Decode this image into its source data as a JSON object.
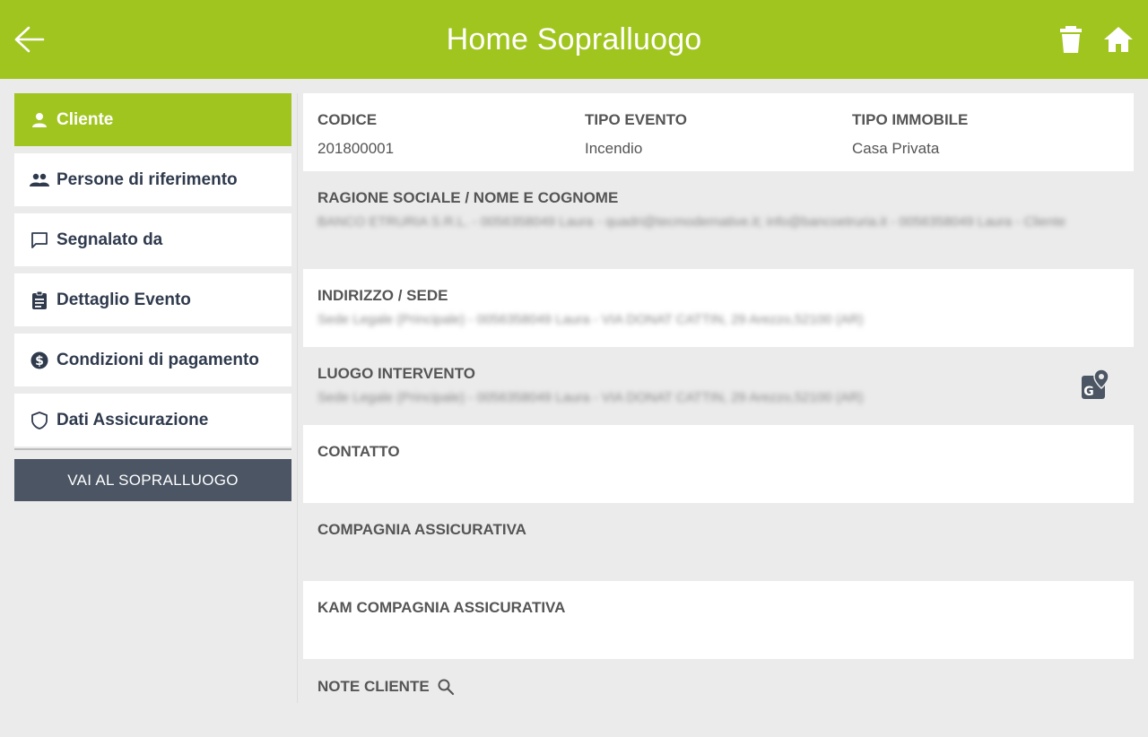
{
  "header": {
    "title": "Home Sopralluogo",
    "back_icon": "arrow-left-icon",
    "delete_icon": "trash-icon",
    "home_icon": "home-icon",
    "bg_color": "#a1c51f"
  },
  "sidebar": {
    "items": [
      {
        "label": "Cliente",
        "icon": "person-icon",
        "active": true
      },
      {
        "label": "Persone di riferimento",
        "icon": "people-icon",
        "active": false
      },
      {
        "label": "Segnalato da",
        "icon": "chat-icon",
        "active": false
      },
      {
        "label": "Dettaglio Evento",
        "icon": "clipboard-icon",
        "active": false
      },
      {
        "label": "Condizioni di pagamento",
        "icon": "dollar-circle-icon",
        "active": false
      },
      {
        "label": "Dati Assicurazione",
        "icon": "shield-icon",
        "active": false
      }
    ],
    "cta_label": "VAI AL SOPRALLUOGO"
  },
  "details": {
    "codice_label": "CODICE",
    "codice_value": "201800001",
    "tipo_evento_label": "TIPO EVENTO",
    "tipo_evento_value": "Incendio",
    "tipo_immobile_label": "TIPO IMMOBILE",
    "tipo_immobile_value": "Casa Privata",
    "ragione_label": "RAGIONE SOCIALE / NOME E COGNOME",
    "ragione_value": "BANCO ETRURIA S.R.L. - 0056358049 Laura - quadri@tecmodernative.it; info@bancoetruria.it - 0056358049 Laura - Cliente",
    "indirizzo_label": "INDIRIZZO / SEDE",
    "indirizzo_value": "Sede Legale (Principale) - 0056358049 Laura - VIA DONAT CATTIN, 29 Arezzo,52100 (AR)",
    "luogo_label": "LUOGO INTERVENTO",
    "luogo_value": "Sede Legale (Principale) - 0056358049 Laura - VIA DONAT CATTIN, 29 Arezzo,52100 (AR)",
    "contatto_label": "CONTATTO",
    "compagnia_label": "COMPAGNIA ASSICURATIVA",
    "kam_label": "KAM COMPAGNIA ASSICURATIVA",
    "note_label": "NOTE CLIENTE"
  }
}
